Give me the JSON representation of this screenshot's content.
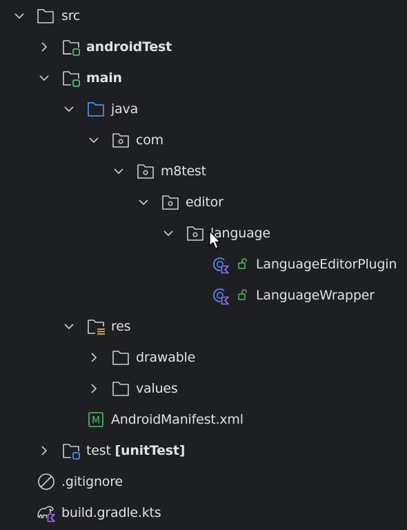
{
  "tree": {
    "src": {
      "label": "src",
      "icon": "folder-icon",
      "expanded": true
    },
    "android_test": {
      "label": "androidTest",
      "icon": "module-folder-icon",
      "badge_color": "#4ec26c",
      "expanded": false
    },
    "main": {
      "label": "main",
      "icon": "module-folder-icon",
      "badge_color": "#4ec26c",
      "expanded": true
    },
    "java": {
      "label": "java",
      "icon": "source-folder-icon",
      "color": "#548af7",
      "expanded": true
    },
    "com": {
      "label": "com",
      "icon": "package-icon",
      "expanded": true
    },
    "m8test": {
      "label": "m8test",
      "icon": "package-icon",
      "expanded": true
    },
    "editor": {
      "label": "editor",
      "icon": "package-icon",
      "expanded": true
    },
    "language": {
      "label": "language",
      "icon": "package-icon",
      "expanded": true
    },
    "language_editor_plugin": {
      "label": "LanguageEditorPlugin",
      "icon": "kotlin-class-icon",
      "visibility_icon": "unlock-icon"
    },
    "language_wrapper": {
      "label": "LanguageWrapper",
      "icon": "kotlin-class-icon",
      "visibility_icon": "unlock-icon"
    },
    "res": {
      "label": "res",
      "icon": "resource-folder-icon",
      "badge_color": "#e8b339",
      "expanded": true
    },
    "drawable": {
      "label": "drawable",
      "icon": "folder-icon",
      "expanded": false
    },
    "values": {
      "label": "values",
      "icon": "folder-icon",
      "expanded": false
    },
    "android_manifest": {
      "label": "AndroidManifest.xml",
      "icon": "manifest-icon",
      "color": "#4ec26c",
      "icon_letter": "M"
    },
    "test": {
      "label": "test",
      "label_extra": "[unitTest]",
      "icon": "module-folder-icon",
      "badge_color": "#548af7",
      "expanded": false
    },
    "gitignore": {
      "label": ".gitignore",
      "icon": "ignored-file-icon"
    },
    "build_gradle": {
      "label": "build.gradle.kts",
      "icon": "gradle-kotlin-icon"
    }
  },
  "colors": {
    "background": "#1e1f22",
    "text": "#dfe1e5",
    "icon_gray": "#ced0d6",
    "kotlin_purple": "#a06ffd",
    "class_blue": "#548af7",
    "public_green": "#5fb865"
  }
}
